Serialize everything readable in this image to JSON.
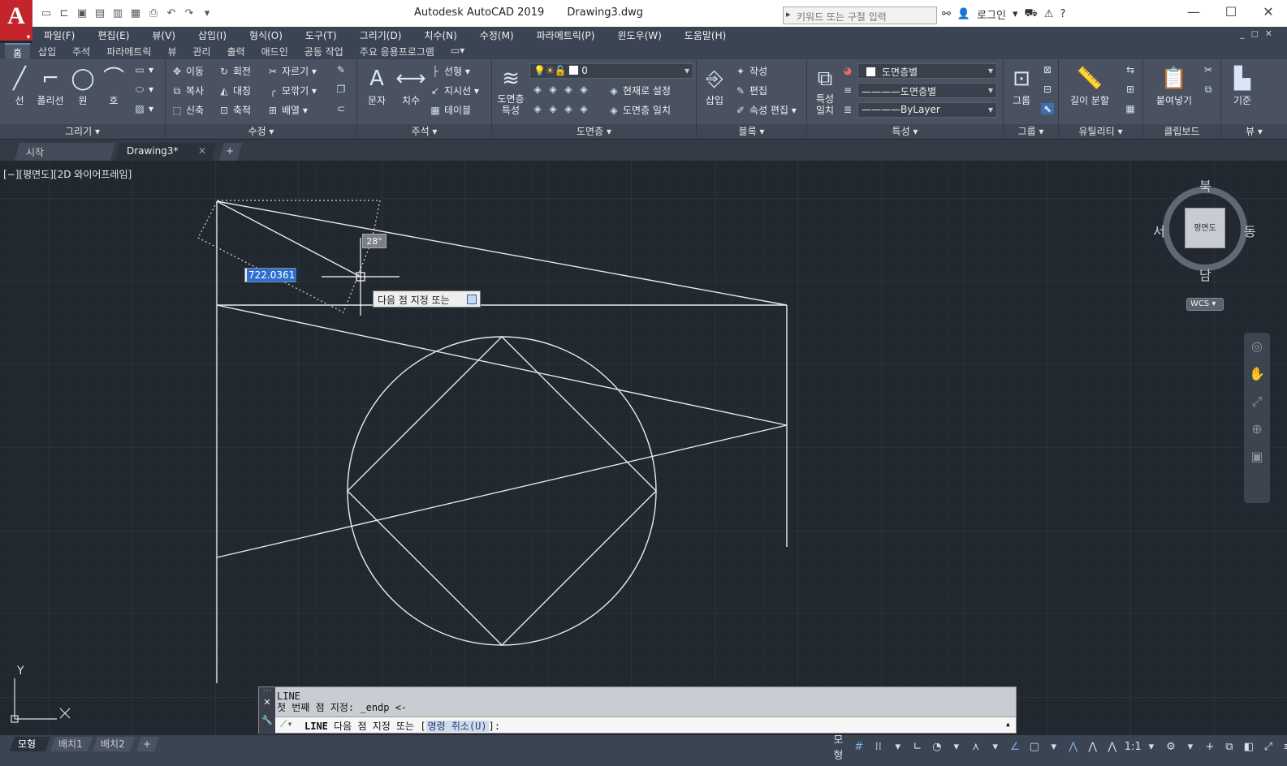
{
  "app": {
    "logo": "A",
    "title": "Autodesk AutoCAD 2019",
    "file": "Drawing3.dwg",
    "search_placeholder": "키워드 또는 구절 입력",
    "login": "로그인"
  },
  "menu": [
    "파일(F)",
    "편집(E)",
    "뷰(V)",
    "삽입(I)",
    "형식(O)",
    "도구(T)",
    "그리기(D)",
    "치수(N)",
    "수정(M)",
    "파라메트릭(P)",
    "윈도우(W)",
    "도움말(H)"
  ],
  "ribbon_tabs": [
    "홈",
    "삽입",
    "주석",
    "파라메트릭",
    "뷰",
    "관리",
    "출력",
    "애드인",
    "공동 작업",
    "주요 응용프로그램"
  ],
  "panels": {
    "draw": {
      "title": "그리기 ▾",
      "line": "선",
      "polyline": "폴리선",
      "circle": "원",
      "arc": "호"
    },
    "modify": {
      "title": "수정 ▾",
      "move": "이동",
      "rotate": "회전",
      "trim": "자르기 ▾",
      "copy": "복사",
      "mirror": "대칭",
      "fillet": "모깎기 ▾",
      "stretch": "신축",
      "scale": "축척",
      "array": "배열 ▾"
    },
    "annotation": {
      "title": "주석 ▾",
      "text": "문자",
      "dimension": "치수",
      "linear": "선형 ▾",
      "leader": "지시선 ▾",
      "table": "테이블"
    },
    "layers": {
      "title": "도면층 ▾",
      "props": "도면층 특성",
      "current_layer": "0",
      "set_current": "현재로 설정",
      "match": "도면층 일치"
    },
    "block": {
      "title": "블록 ▾",
      "insert": "삽입",
      "create": "작성",
      "edit": "편집",
      "attr_edit": "속성 편집 ▾"
    },
    "properties": {
      "title": "특성 ▾",
      "match": "특성 일치",
      "color": "도면층별",
      "linetype": "도면층별",
      "lineweight": "ByLayer"
    },
    "groups": {
      "title": "그룹 ▾",
      "group": "그룹"
    },
    "utilities": {
      "title": "유틸리티 ▾",
      "measure": "길이 분할"
    },
    "clipboard": {
      "title": "클립보드",
      "paste": "붙여넣기"
    },
    "view": {
      "title": "뷰 ▾",
      "base": "기준"
    }
  },
  "doc_tabs": [
    "시작",
    "Drawing3*"
  ],
  "viewport": {
    "label": "[−][평면도][2D 와이어프레임]",
    "angle": "28°",
    "length_value": "722.0361",
    "next_point_prompt": "다음 점 지정 또는"
  },
  "navcube": {
    "north": "북",
    "south": "남",
    "east": "동",
    "west": "서",
    "face": "평면도",
    "wcs": "WCS"
  },
  "ucs": {
    "x": "X",
    "y": "Y"
  },
  "command": {
    "history_1": "LINE",
    "history_2": "첫 번째 점 지정: _endp <-",
    "prompt_cmd": "LINE",
    "prompt_text": "다음 점 지정 또는 [",
    "prompt_option": "명령 취소(U)",
    "prompt_end": "]:"
  },
  "layout_tabs": [
    "모형",
    "배치1",
    "배치2"
  ],
  "status": {
    "model": "모형",
    "scale": "1:1"
  }
}
